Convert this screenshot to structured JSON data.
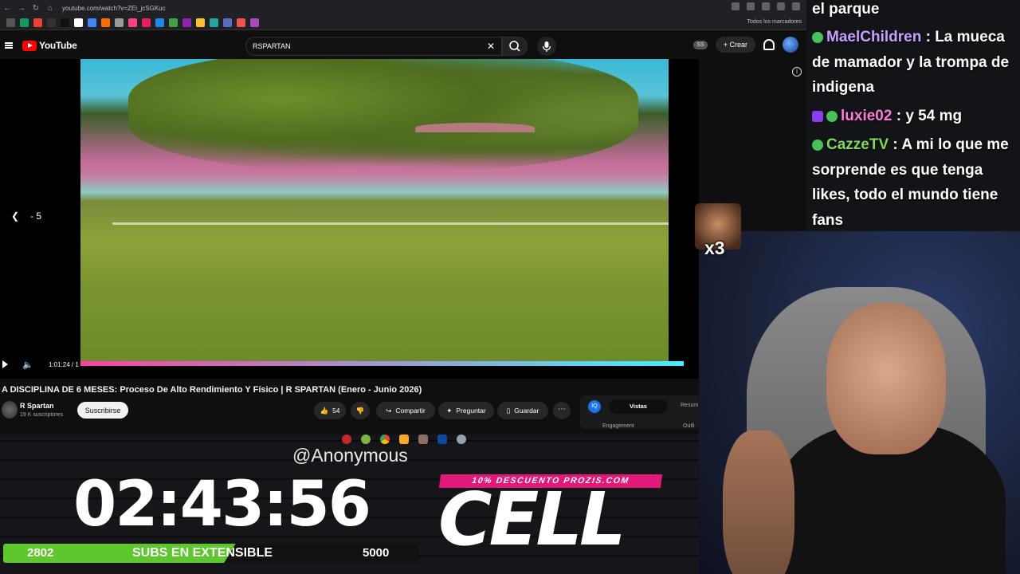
{
  "browser": {
    "url": "youtube.com/watch?v=ZEi_jcSGKuc",
    "bookmarks_label": "Todos los marcadores"
  },
  "youtube": {
    "logo": "YouTube",
    "search_value": "RSPARTAN",
    "create_label": "Crear",
    "chip": "SS"
  },
  "video": {
    "skip_label": "- 5",
    "time_label": "1:01:24 / 1",
    "progress": 0.83,
    "title": "A DISCIPLINA DE 6 MESES: Proceso De Alto Rendimiento Y Físico | R SPARTAN (Enero - Junio 2026)",
    "channel_name": "R Spartan",
    "channel_subs": "19 K suscriptores",
    "subscribe_label": "Suscribirse",
    "likes": "54",
    "share_label": "Compartir",
    "ask_label": "Preguntar",
    "save_label": "Guardar"
  },
  "side_panel": {
    "icon_label": "IQ",
    "tab_active": "Vistas",
    "tab_other": "Resum",
    "label_left": "Engagement",
    "label_right": "Outli"
  },
  "overlay": {
    "handle": "@Anonymous",
    "timer": "02:43:56",
    "subs_current": "2802",
    "subs_label": "SUBS EN EXTENSIBLE",
    "subs_goal": "5000",
    "subs_fraction": 0.56,
    "promo": "10% DESCUENTO PROZIS.COM",
    "brand": "CELL",
    "emote_multiplier": "x3"
  },
  "chat": {
    "messages": [
      {
        "text": "el parque"
      },
      {
        "user": "MaelChildren",
        "color": "#c9a0ff",
        "text": ": La mueca de mamador y la trompa de indigena"
      },
      {
        "user": "luxie02",
        "color": "#ff7ad9",
        "text": ": y 54 mg"
      },
      {
        "user": "CazzeTV",
        "color": "#7ed957",
        "text": ": A mi lo que me sorprende es que tenga likes, todo el mundo tiene fans"
      }
    ]
  },
  "colors": {
    "progress_start": "#ff3ea5",
    "progress_end": "#3df0ff",
    "subs_bar": "#5ec72e",
    "promo_bg": "#e3197a",
    "youtube_red": "#ff0000"
  }
}
